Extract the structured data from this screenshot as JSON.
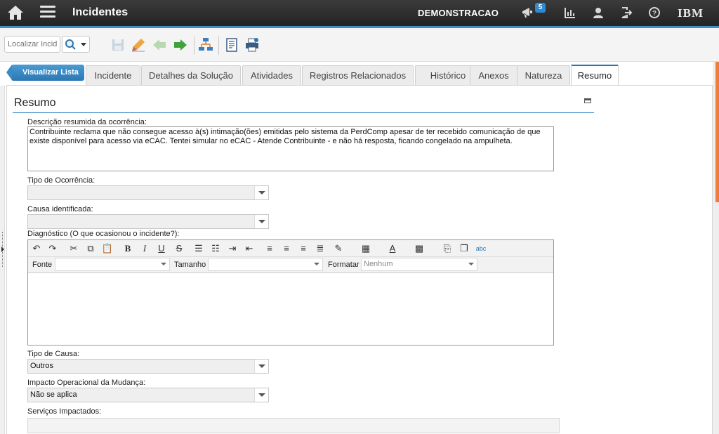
{
  "header": {
    "title": "Incidentes",
    "org": "DEMONSTRACAO",
    "notifications_count": "5",
    "brand": "IBM"
  },
  "toolbar": {
    "search_placeholder": "Localizar Incidente"
  },
  "nav": {
    "back_label": "Visualizar Lista",
    "tabs": [
      {
        "label": "Incidente"
      },
      {
        "label": "Detalhes da Solução"
      },
      {
        "label": "Atividades"
      },
      {
        "label": "Registros Relacionados"
      },
      {
        "label": "Histórico"
      },
      {
        "label": "Anexos"
      },
      {
        "label": "Natureza"
      },
      {
        "label": "Resumo",
        "active": true
      }
    ]
  },
  "section": {
    "title": "Resumo"
  },
  "form": {
    "descricao_label": "Descrição resumida da ocorrência:",
    "descricao_value": "Contribuinte reclama que não consegue acesso à(s) intimação(ões) emitidas pelo sistema da PerdComp apesar de ter recebido comunicação de que existe disponível para acesso via eCAC. Tentei simular no eCAC - Atende Contribuinte - e não há resposta, ficando congelado na ampulheta.",
    "tipo_ocorrencia_label": "Tipo de Ocorrência:",
    "tipo_ocorrencia_value": "",
    "causa_label": "Causa identificada:",
    "causa_value": "",
    "diagnostico_label": "Diagnóstico (O que ocasionou o incidente?):",
    "editor": {
      "fonte_label": "Fonte",
      "tamanho_label": "Tamanho",
      "formatar_label": "Formatar",
      "formatar_value": "Nenhum"
    },
    "tipo_causa_label": "Tipo de Causa:",
    "tipo_causa_value": "Outros",
    "impacto_label": "Impacto Operacional da Mudança:",
    "impacto_value": "Não se aplica",
    "servicos_label": "Serviços Impactados:"
  },
  "colors": {
    "accent": "#3c90c8",
    "topbar": "#2a2a2a",
    "scroll_thumb": "#ef7d3d"
  }
}
